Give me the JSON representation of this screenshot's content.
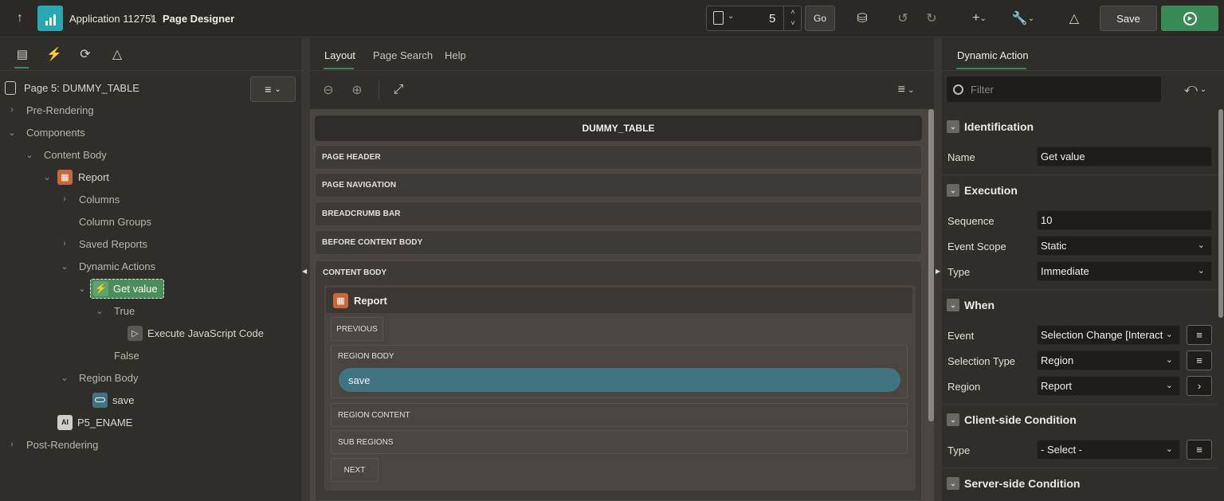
{
  "header": {
    "app_title": "Application 112751",
    "separator": "\\",
    "page_title": "Page Designer",
    "page_number": "5",
    "go_label": "Go",
    "save_label": "Save"
  },
  "left_panel": {
    "page_label": "Page 5: DUMMY_TABLE",
    "tree": {
      "pre_rendering": "Pre-Rendering",
      "components": "Components",
      "content_body": "Content Body",
      "report": "Report",
      "columns": "Columns",
      "column_groups": "Column Groups",
      "saved_reports": "Saved Reports",
      "dynamic_actions": "Dynamic Actions",
      "get_value": "Get value",
      "true_label": "True",
      "execute_js": "Execute JavaScript Code",
      "false_label": "False",
      "region_body": "Region Body",
      "save": "save",
      "p5_ename": "P5_ENAME",
      "post_rendering": "Post-Rendering"
    }
  },
  "middle_panel": {
    "tabs": [
      "Layout",
      "Page Search",
      "Help"
    ],
    "page_name": "DUMMY_TABLE",
    "slots": {
      "page_header": "PAGE HEADER",
      "page_navigation": "PAGE NAVIGATION",
      "breadcrumb_bar": "BREADCRUMB BAR",
      "before_content_body": "BEFORE CONTENT BODY",
      "content_body": "CONTENT BODY"
    },
    "report": {
      "title": "Report",
      "previous": "PREVIOUS",
      "region_body": "REGION BODY",
      "save_button": "save",
      "region_content": "REGION CONTENT",
      "sub_regions": "SUB REGIONS",
      "next": "NEXT"
    }
  },
  "right_panel": {
    "tab": "Dynamic Action",
    "filter_placeholder": "Filter",
    "sections": {
      "identification": "Identification",
      "execution": "Execution",
      "when": "When",
      "client_side_condition": "Client-side Condition",
      "server_side_condition": "Server-side Condition"
    },
    "fields": {
      "name_label": "Name",
      "name_value": "Get value",
      "sequence_label": "Sequence",
      "sequence_value": "10",
      "event_scope_label": "Event Scope",
      "event_scope_value": "Static",
      "type_label": "Type",
      "type_value": "Immediate",
      "event_label": "Event",
      "event_value": "Selection Change [Interacti",
      "selection_type_label": "Selection Type",
      "selection_type_value": "Region",
      "region_label": "Region",
      "region_value": "Report",
      "client_type_label": "Type",
      "client_type_value": "- Select -"
    }
  },
  "colors": {
    "accent_green": "#3a8a55",
    "selected_node": "#4a8f5b",
    "teal_button": "#3f7480",
    "app_icon": "#27a9b4"
  }
}
